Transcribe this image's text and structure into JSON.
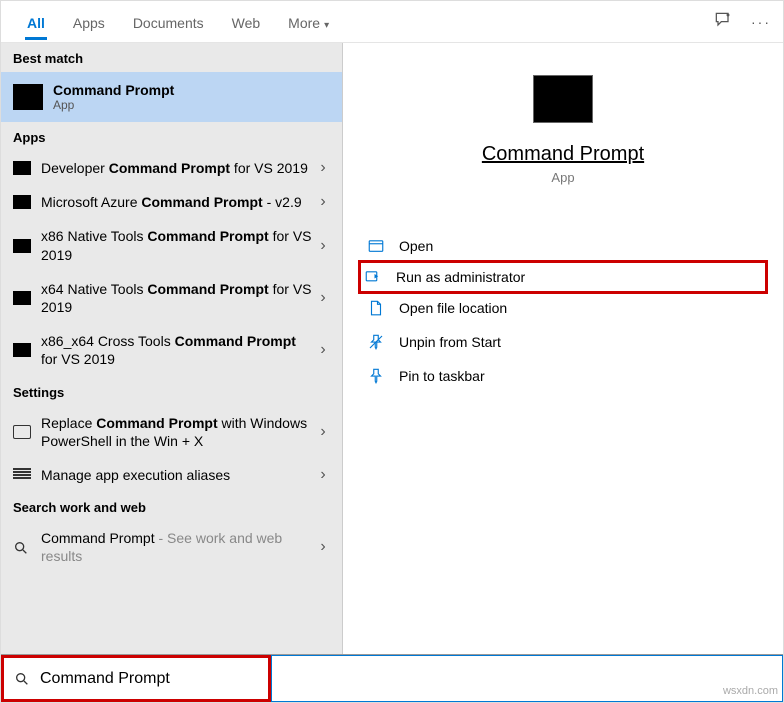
{
  "tabs": {
    "all": "All",
    "apps": "Apps",
    "documents": "Documents",
    "web": "Web",
    "more": "More"
  },
  "sections": {
    "best": "Best match",
    "apps": "Apps",
    "settings": "Settings",
    "web": "Search work and web"
  },
  "best_match": {
    "title": "Command Prompt",
    "subtitle": "App"
  },
  "apps_list": [
    {
      "prefix": "Developer ",
      "bold": "Command Prompt",
      "suffix": " for VS 2019"
    },
    {
      "prefix": "Microsoft Azure ",
      "bold": "Command Prompt",
      "suffix": " - v2.9"
    },
    {
      "prefix": "x86 Native Tools ",
      "bold": "Command Prompt",
      "suffix": " for VS 2019"
    },
    {
      "prefix": "x64 Native Tools ",
      "bold": "Command Prompt",
      "suffix": " for VS 2019"
    },
    {
      "prefix": "x86_x64 Cross Tools ",
      "bold": "Command Prompt",
      "suffix": " for VS 2019"
    }
  ],
  "settings_list": [
    {
      "prefix": "Replace ",
      "bold": "Command Prompt",
      "suffix": " with Windows PowerShell in the Win + X"
    },
    {
      "text": "Manage app execution aliases"
    }
  ],
  "web_list": {
    "title": "Command Prompt",
    "sub": " - See work and web results"
  },
  "preview": {
    "title": "Command Prompt",
    "subtitle": "App"
  },
  "actions": {
    "open": "Open",
    "admin": "Run as administrator",
    "location": "Open file location",
    "unpin": "Unpin from Start",
    "pin": "Pin to taskbar"
  },
  "search": {
    "value": "Command Prompt"
  },
  "watermark": "wsxdn.com"
}
